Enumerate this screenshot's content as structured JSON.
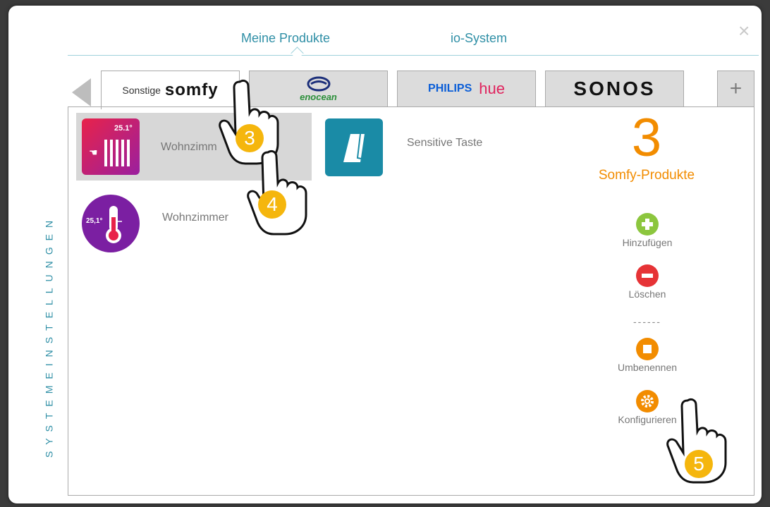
{
  "close_symbol": "×",
  "tabs": [
    {
      "label": "Meine Produkte",
      "active": true
    },
    {
      "label": "io-System",
      "active": false
    }
  ],
  "sidebar_vertical_text": "SYSTEMEINSTELLUNGEN",
  "brands": {
    "somfy": {
      "prefix": "Sonstige",
      "logo": "somfy"
    },
    "enocean": {
      "logo": "enocean"
    },
    "philips": {
      "logo_left": "PHILIPS",
      "logo_right": "hue"
    },
    "sonos": {
      "logo": "SONOS"
    }
  },
  "add_brand_symbol": "+",
  "devices": [
    {
      "label": "Wohnzimm",
      "tile_text": "25.1°",
      "icon": "heater-tile-icon",
      "selected": true
    },
    {
      "label": "Sensitive Taste",
      "icon": "sensitive-switch-icon"
    },
    {
      "label": "Wohnzimmer",
      "tile_text": "25,1°",
      "icon": "thermometer-icon"
    }
  ],
  "summary": {
    "count": "3",
    "label": "Somfy-Produkte"
  },
  "actions": {
    "add": "Hinzufügen",
    "delete": "Löschen",
    "separator": "------",
    "rename": "Umbenennen",
    "configure": "Konfigurieren"
  },
  "annotations": {
    "a3": "3",
    "a4": "4",
    "a5": "5"
  },
  "colors": {
    "accent": "#2f8fa6",
    "orange": "#f28c00",
    "green": "#8cc63e",
    "red": "#e63336",
    "badge": "#f5b60d"
  }
}
